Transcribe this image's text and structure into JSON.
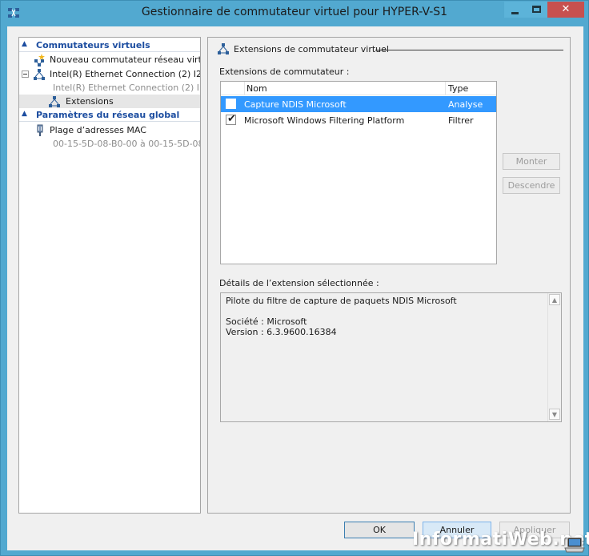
{
  "window": {
    "title": "Gestionnaire de commutateur virtuel pour HYPER-V-S1",
    "controls": {
      "minimize": "minimize",
      "maximize": "maximize",
      "close": "✕"
    }
  },
  "tree": {
    "section1": {
      "label": "Commutateurs virtuels"
    },
    "new_switch": "Nouveau commutateur réseau virtuel",
    "switch_name": "Intel(R) Ethernet Connection (2) I2...",
    "switch_sub": "Intel(R) Ethernet Connection (2) I...",
    "extensions": "Extensions",
    "section2": {
      "label": "Paramètres du réseau global"
    },
    "mac_range": "Plage d’adresses MAC",
    "mac_value": "00-15-5D-08-B0-00 à 00-15-5D-08..."
  },
  "panel": {
    "group_title": "Extensions de commutateur virtuel",
    "list_label": "Extensions de commutateur :",
    "columns": {
      "name": "Nom",
      "type": "Type"
    },
    "rows": [
      {
        "name": "Capture NDIS Microsoft",
        "type": "Analyse",
        "checked": false,
        "selected": true
      },
      {
        "name": "Microsoft Windows Filtering Platform",
        "type": "Filtrer",
        "checked": true,
        "selected": false
      }
    ],
    "buttons": {
      "up": "Monter",
      "down": "Descendre"
    },
    "details_label": "Détails de l’extension sélectionnée :",
    "details": {
      "description": "Pilote du filtre de capture de paquets NDIS Microsoft",
      "company": "Société : Microsoft",
      "version": "Version : 6.3.9600.16384"
    }
  },
  "footer": {
    "ok": "OK",
    "cancel": "Annuler",
    "apply": "Appliquer"
  },
  "watermark": "InformatiWeb.net",
  "colors": {
    "section_header": "#1c4da0",
    "selection": "#3399ff",
    "title_bar": "#52a9d0",
    "close_button": "#c7504f"
  }
}
